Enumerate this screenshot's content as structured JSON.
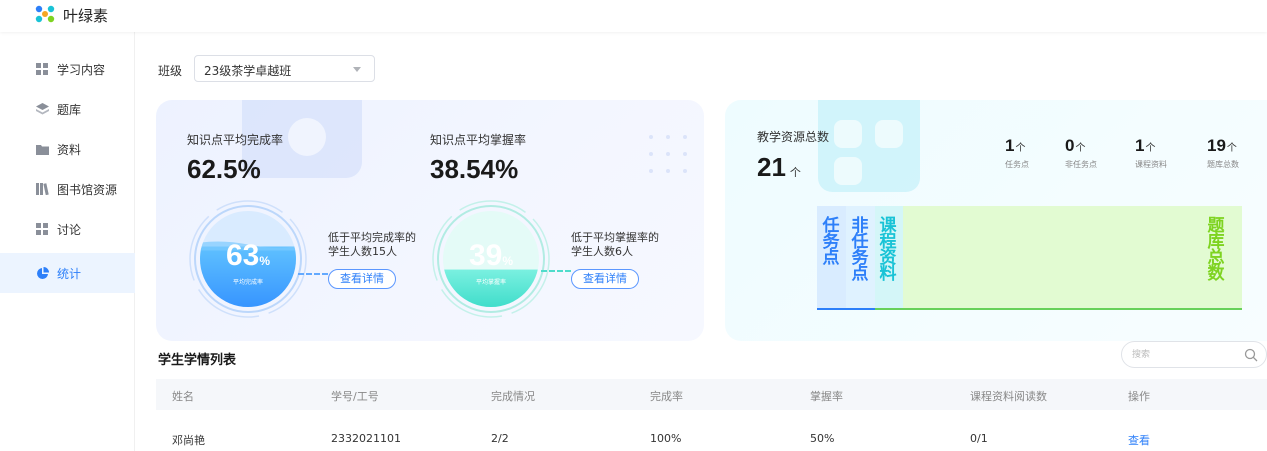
{
  "app": {
    "title": "叶绿素"
  },
  "sidebar": {
    "items": [
      {
        "label": "学习内容",
        "icon": "grid-icon",
        "active": false
      },
      {
        "label": "题库",
        "icon": "layers-icon",
        "active": false
      },
      {
        "label": "资料",
        "icon": "folder-icon",
        "active": false
      },
      {
        "label": "图书馆资源",
        "icon": "books-icon",
        "active": false
      },
      {
        "label": "讨论",
        "icon": "grid-icon",
        "active": false
      },
      {
        "label": "统计",
        "icon": "pie-chart-icon",
        "active": true
      }
    ]
  },
  "filter": {
    "label": "班级",
    "selected": "23级茶学卓越班"
  },
  "completion": {
    "label": "知识点平均完成率",
    "value": "62.5%",
    "circle_number": "63",
    "circle_unit": "%",
    "circle_caption": "平均完成率",
    "fill": 0.63,
    "note_line1": "低于平均完成率的",
    "note_line2": "学生人数15人",
    "detail_label": "查看详情"
  },
  "mastery": {
    "label": "知识点平均掌握率",
    "value": "38.54%",
    "circle_number": "39",
    "circle_unit": "%",
    "circle_caption": "平均掌握率",
    "fill": 0.39,
    "note_line1": "低于平均掌握率的",
    "note_line2": "学生人数6人",
    "detail_label": "查看详情"
  },
  "resources": {
    "label": "教学资源总数",
    "total": "21",
    "unit": "个",
    "stats": [
      {
        "value": "1",
        "unit": "个",
        "name": "任务点"
      },
      {
        "value": "0",
        "unit": "个",
        "name": "非任务点"
      },
      {
        "value": "1",
        "unit": "个",
        "name": "课程资料"
      },
      {
        "value": "19",
        "unit": "个",
        "name": "题库总数"
      }
    ],
    "segments": [
      {
        "label": "任务点",
        "color": "#2d7ff9"
      },
      {
        "label": "非任务点",
        "color": "#2d7ff9"
      },
      {
        "label": "课程资料",
        "color": "#19c3d6"
      },
      {
        "label": "题库总数",
        "color": "#7ed321"
      }
    ]
  },
  "table": {
    "title": "学生学情列表",
    "search_placeholder": "搜索",
    "columns": [
      "姓名",
      "学号/工号",
      "完成情况",
      "完成率",
      "掌握率",
      "课程资料阅读数",
      "操作"
    ],
    "rows": [
      [
        "邓尚艳",
        "2332021101",
        "2/2",
        "100%",
        "50%",
        "0/1",
        "查看"
      ]
    ]
  },
  "colors": {
    "accent": "#2d7ff9",
    "teal": "#19c3d6",
    "green": "#7ed321"
  }
}
